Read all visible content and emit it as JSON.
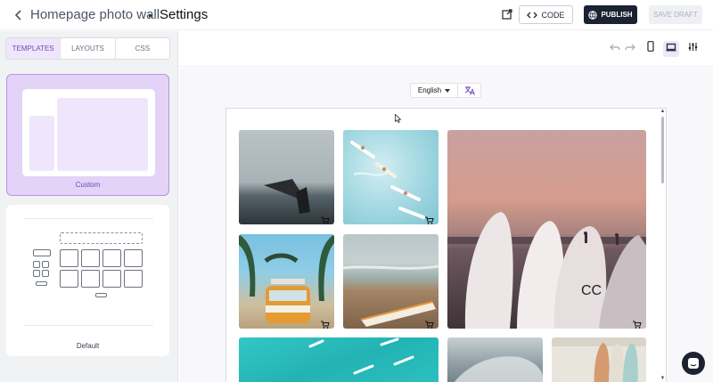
{
  "header": {
    "breadcrumb_parent": "Homepage photo wall",
    "breadcrumb_separator": "▸",
    "breadcrumb_current": "Settings",
    "code_label": "CODE",
    "publish_label": "PUBLISH",
    "save_draft_label": "SAVE DRAFT"
  },
  "sidebar": {
    "tabs": [
      {
        "label": "TEMPLATES",
        "active": true
      },
      {
        "label": "LAYOUTS",
        "active": false
      },
      {
        "label": "CSS",
        "active": false
      }
    ],
    "templates": [
      {
        "label": "Custom",
        "selected": true
      },
      {
        "label": "Default",
        "selected": false
      }
    ]
  },
  "toolbar": {
    "icons": [
      "undo-icon",
      "redo-icon",
      "mobile-icon",
      "desktop-icon",
      "sliders-icon"
    ],
    "active_device": "desktop"
  },
  "language": {
    "selected": "English",
    "translate_icon": "translate-icon"
  },
  "photos": [
    {
      "name": "photo-cliff-diver",
      "colors": [
        "#c7cdd0",
        "#6f7b82",
        "#2c3438"
      ]
    },
    {
      "name": "photo-surfers-aerial",
      "colors": [
        "#a6d8e2",
        "#c5e9ee",
        "#7ac1cf"
      ]
    },
    {
      "name": "photo-surfboards-sunset",
      "colors": [
        "#d39a8e",
        "#8c6e79",
        "#4a3b40"
      ]
    },
    {
      "name": "photo-orange-van",
      "colors": [
        "#6fb7d9",
        "#e5a13b",
        "#2f5a3c"
      ]
    },
    {
      "name": "photo-beach-surfboard",
      "colors": [
        "#b7c4c4",
        "#9a7d60",
        "#6e563f"
      ]
    },
    {
      "name": "photo-turquoise-water",
      "colors": [
        "#2dc0c2",
        "#3fc9c8",
        "#1ea5a9"
      ]
    },
    {
      "name": "photo-wave",
      "colors": [
        "#aab6bb",
        "#7e8e95",
        "#d8dcdd"
      ]
    },
    {
      "name": "photo-surfboard-rack",
      "colors": [
        "#e4e3da",
        "#d79c74",
        "#9fcac7"
      ]
    }
  ],
  "colors": {
    "accent": "#6d4ab8",
    "publish_bg": "#1b2233",
    "selected_card": "#e2d3f7"
  }
}
